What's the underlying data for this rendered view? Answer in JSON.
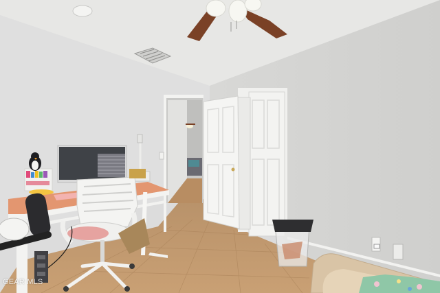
{
  "photo": {
    "watermark": "GEAR MLS",
    "colors": {
      "ceiling": "#e6e6e4",
      "wall_left": "#dedede",
      "wall_right": "#d4d4d2",
      "floor": "#c59c6e",
      "door": "#f4f4f2",
      "desk_top": "#e39670",
      "monitor_screen": "#3f4247",
      "fan_blade": "#7a4126"
    }
  }
}
